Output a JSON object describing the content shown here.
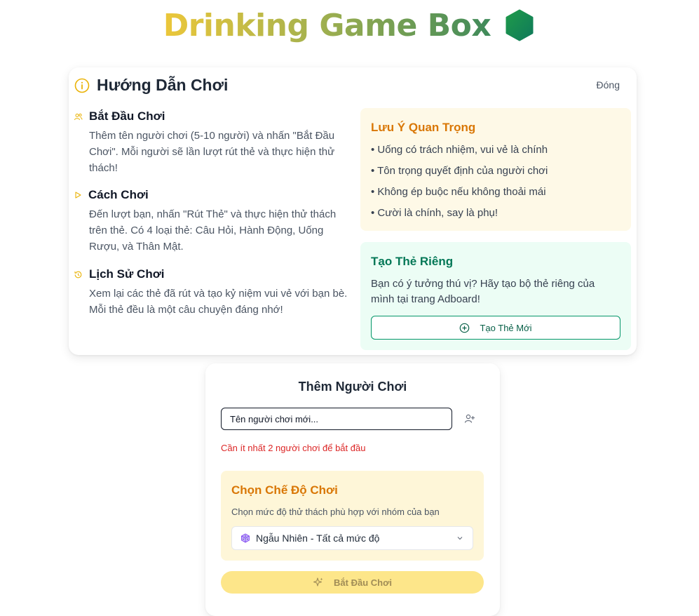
{
  "header": {
    "title": "Drinking Game Box",
    "logo_icon": "green-hexagon-logo"
  },
  "guide": {
    "title": "Hướng Dẫn Chơi",
    "close_label": "Đóng",
    "steps": [
      {
        "icon": "users-icon",
        "title": "Bắt Đầu Chơi",
        "desc": "Thêm tên người chơi (5-10 người) và nhấn \"Bắt Đầu Chơi\". Mỗi người sẽ lần lượt rút thẻ và thực hiện thử thách!"
      },
      {
        "icon": "play-icon",
        "title": "Cách Chơi",
        "desc": "Đến lượt bạn, nhấn \"Rút Thẻ\" và thực hiện thử thách trên thẻ. Có 4 loại thẻ: Câu Hỏi, Hành Động, Uống Rượu, và Thân Mật."
      },
      {
        "icon": "history-icon",
        "title": "Lịch Sử Chơi",
        "desc": "Xem lại các thẻ đã rút và tạo kỷ niệm vui vẻ với bạn bè. Mỗi thẻ đều là một câu chuyện đáng nhớ!"
      }
    ],
    "note": {
      "title": "Lưu Ý Quan Trọng",
      "items": [
        "• Uống có trách nhiệm, vui vẻ là chính",
        "• Tôn trọng quyết định của người chơi",
        "• Không ép buộc nếu không thoải mái",
        "• Cười là chính, say là phụ!"
      ]
    },
    "custom": {
      "title": "Tạo Thẻ Riêng",
      "desc": "Bạn có ý tưởng thú vị? Hãy tạo bộ thẻ riêng của mình tại trang Adboard!",
      "button_label": "Tạo Thẻ Mới"
    }
  },
  "players": {
    "title": "Thêm Người Chơi",
    "input_placeholder": "Tên người chơi mới...",
    "error": "Cần ít nhất 2 người chơi để bắt đầu",
    "mode": {
      "title": "Chọn Chế Độ Chơi",
      "desc": "Chọn mức độ thử thách phù hợp với nhóm của bạn",
      "selected": "Ngẫu Nhiên - Tất cả mức độ",
      "selected_icon": "dice-icon"
    },
    "start_label": "Bắt Đầu Chơi"
  },
  "colors": {
    "accent_yellow": "#ecc73a",
    "accent_green": "#3f8a5a",
    "warning_orange": "#d97706",
    "success_green": "#047857",
    "error_red": "#dc2626"
  }
}
